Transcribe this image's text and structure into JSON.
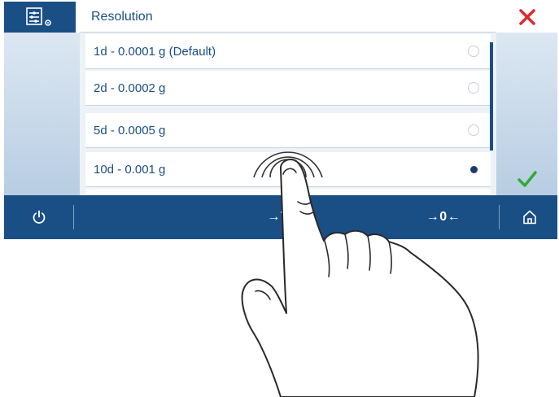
{
  "header": {
    "title": "Resolution"
  },
  "options": [
    {
      "label": "1d - 0.0001 g (Default)",
      "selected": false
    },
    {
      "label": "2d - 0.0002 g",
      "selected": false
    },
    {
      "label": "5d - 0.0005 g",
      "selected": false
    },
    {
      "label": "10d - 0.001 g",
      "selected": true
    }
  ],
  "bottom_bar": {
    "power_icon": "power-icon",
    "tare_label": "→T←",
    "zero_label": "→0←",
    "home_icon": "home-icon"
  },
  "colors": {
    "brand_blue": "#1a4f86",
    "close_red": "#e0282e",
    "confirm_green": "#2eaa3a"
  }
}
